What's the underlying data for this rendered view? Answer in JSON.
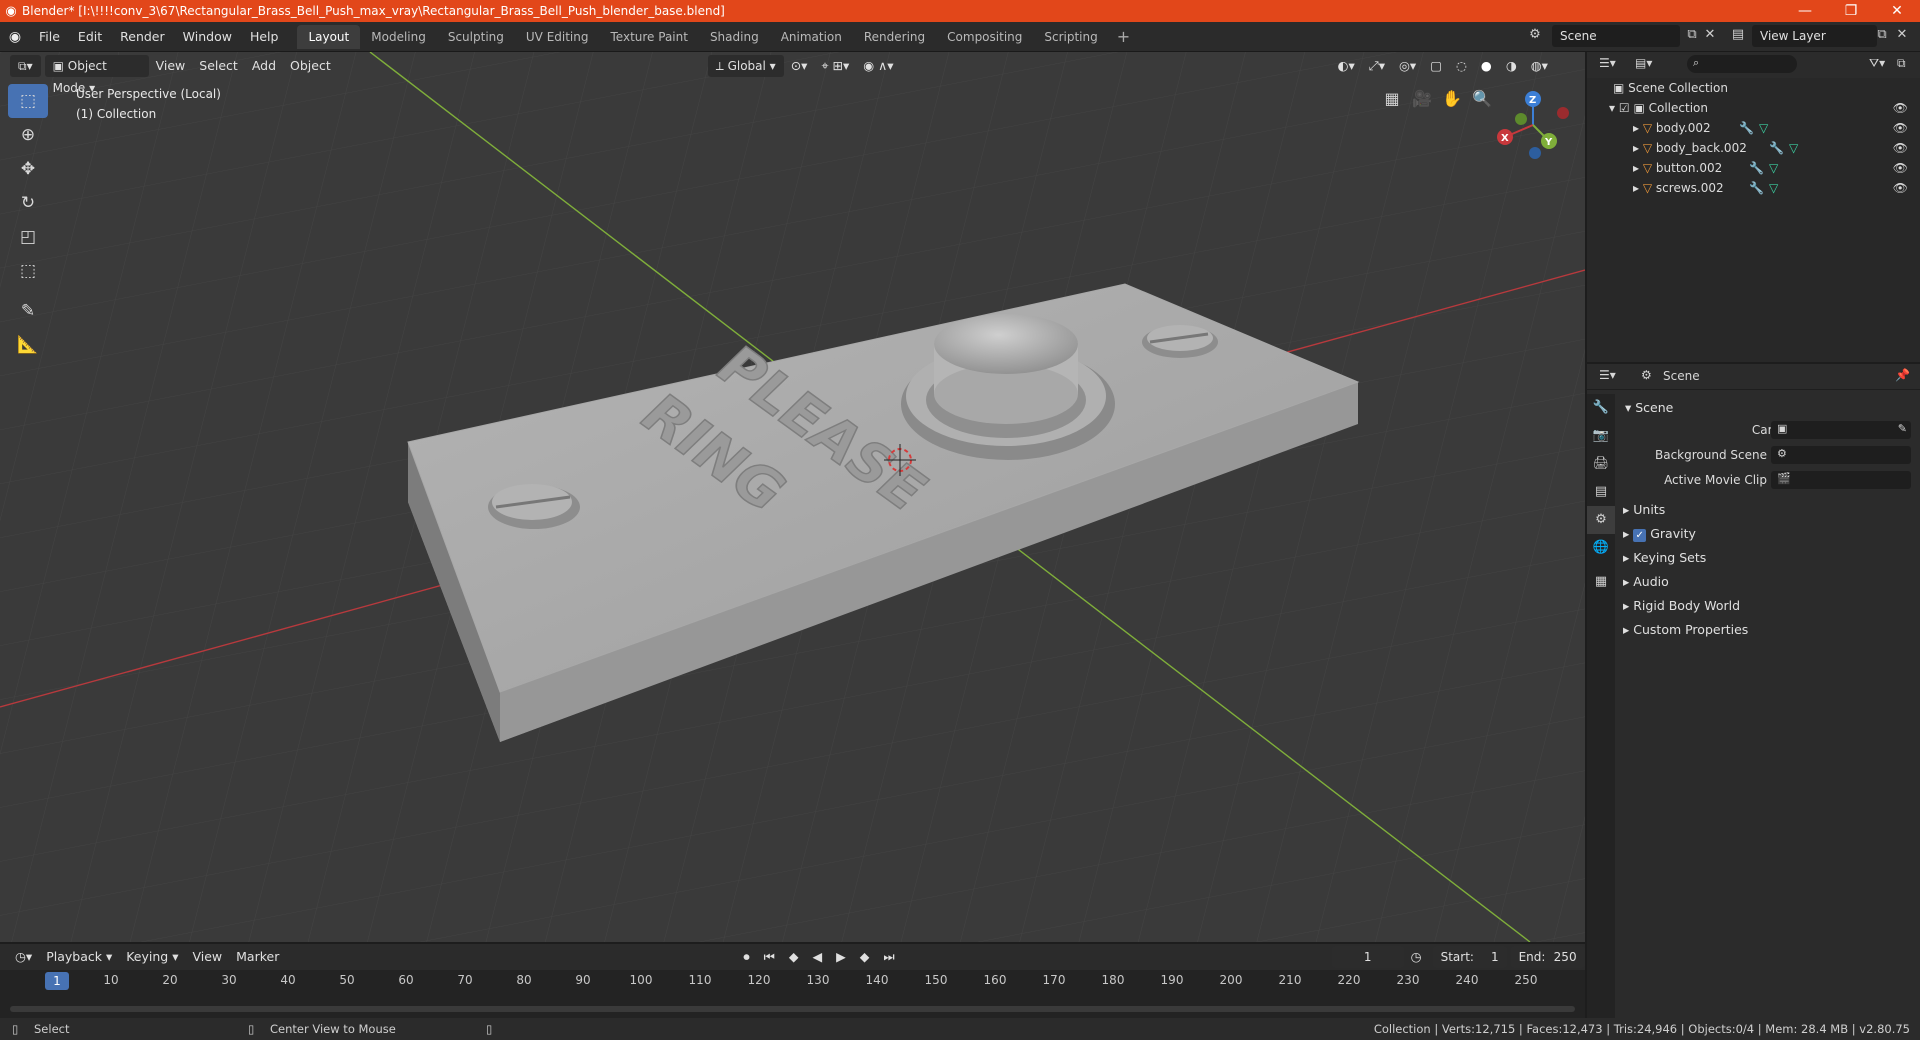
{
  "window": {
    "title": "Blender* [I:\\!!!!conv_3\\67\\Rectangular_Brass_Bell_Push_max_vray\\Rectangular_Brass_Bell_Push_blender_base.blend]",
    "controls": [
      "—",
      "❐",
      "✕"
    ]
  },
  "menubar": {
    "menus": [
      "File",
      "Edit",
      "Render",
      "Window",
      "Help"
    ],
    "tabs": [
      "Layout",
      "Modeling",
      "Sculpting",
      "UV Editing",
      "Texture Paint",
      "Shading",
      "Animation",
      "Rendering",
      "Compositing",
      "Scripting"
    ],
    "active_tab": "Layout",
    "scene": "Scene",
    "view_layer": "View Layer"
  },
  "viewport": {
    "mode": "Object Mode",
    "menus": [
      "View",
      "Select",
      "Add",
      "Object"
    ],
    "transform_orientation": "Global",
    "info_line1": "User Perspective (Local)",
    "info_line2": "(1) Collection",
    "model_text_line1": "PLEASE",
    "model_text_line2": "RING",
    "gizmo": {
      "x": "X",
      "y": "Y",
      "z": "Z"
    }
  },
  "outliner": {
    "root": "Scene Collection",
    "collection": "Collection",
    "objects": [
      "body.002",
      "body_back.002",
      "button.002",
      "screws.002"
    ],
    "search_placeholder": ""
  },
  "properties": {
    "context": "Scene",
    "panel": "Scene",
    "camera_label": "Camera",
    "background_scene_label": "Background Scene",
    "active_movie_clip_label": "Active Movie Clip",
    "sections": [
      "Units",
      "Gravity",
      "Keying Sets",
      "Audio",
      "Rigid Body World",
      "Custom Properties"
    ],
    "gravity_checked": true
  },
  "timeline": {
    "menus": [
      "Playback",
      "Keying",
      "View",
      "Marker"
    ],
    "current_frame": "1",
    "start_label": "Start:",
    "start": "1",
    "end_label": "End:",
    "end": "250",
    "ticks": [
      "10",
      "20",
      "30",
      "40",
      "50",
      "60",
      "70",
      "80",
      "90",
      "100",
      "110",
      "120",
      "130",
      "140",
      "150",
      "160",
      "170",
      "180",
      "190",
      "200",
      "210",
      "220",
      "230",
      "240",
      "250"
    ]
  },
  "statusbar": {
    "left_action": "Select",
    "middle_action": "Center View to Mouse",
    "stats": "Collection | Verts:12,715 | Faces:12,473 | Tris:24,946 | Objects:0/4 | Mem: 28.4 MB | v2.80.75"
  },
  "colors": {
    "title_bar": "#e2471a",
    "accent_blue": "#4772b3",
    "axis_x": "#c8383c",
    "axis_y": "#7fae3a",
    "axis_z": "#3c7fd6",
    "object_orange": "#e8963a"
  }
}
